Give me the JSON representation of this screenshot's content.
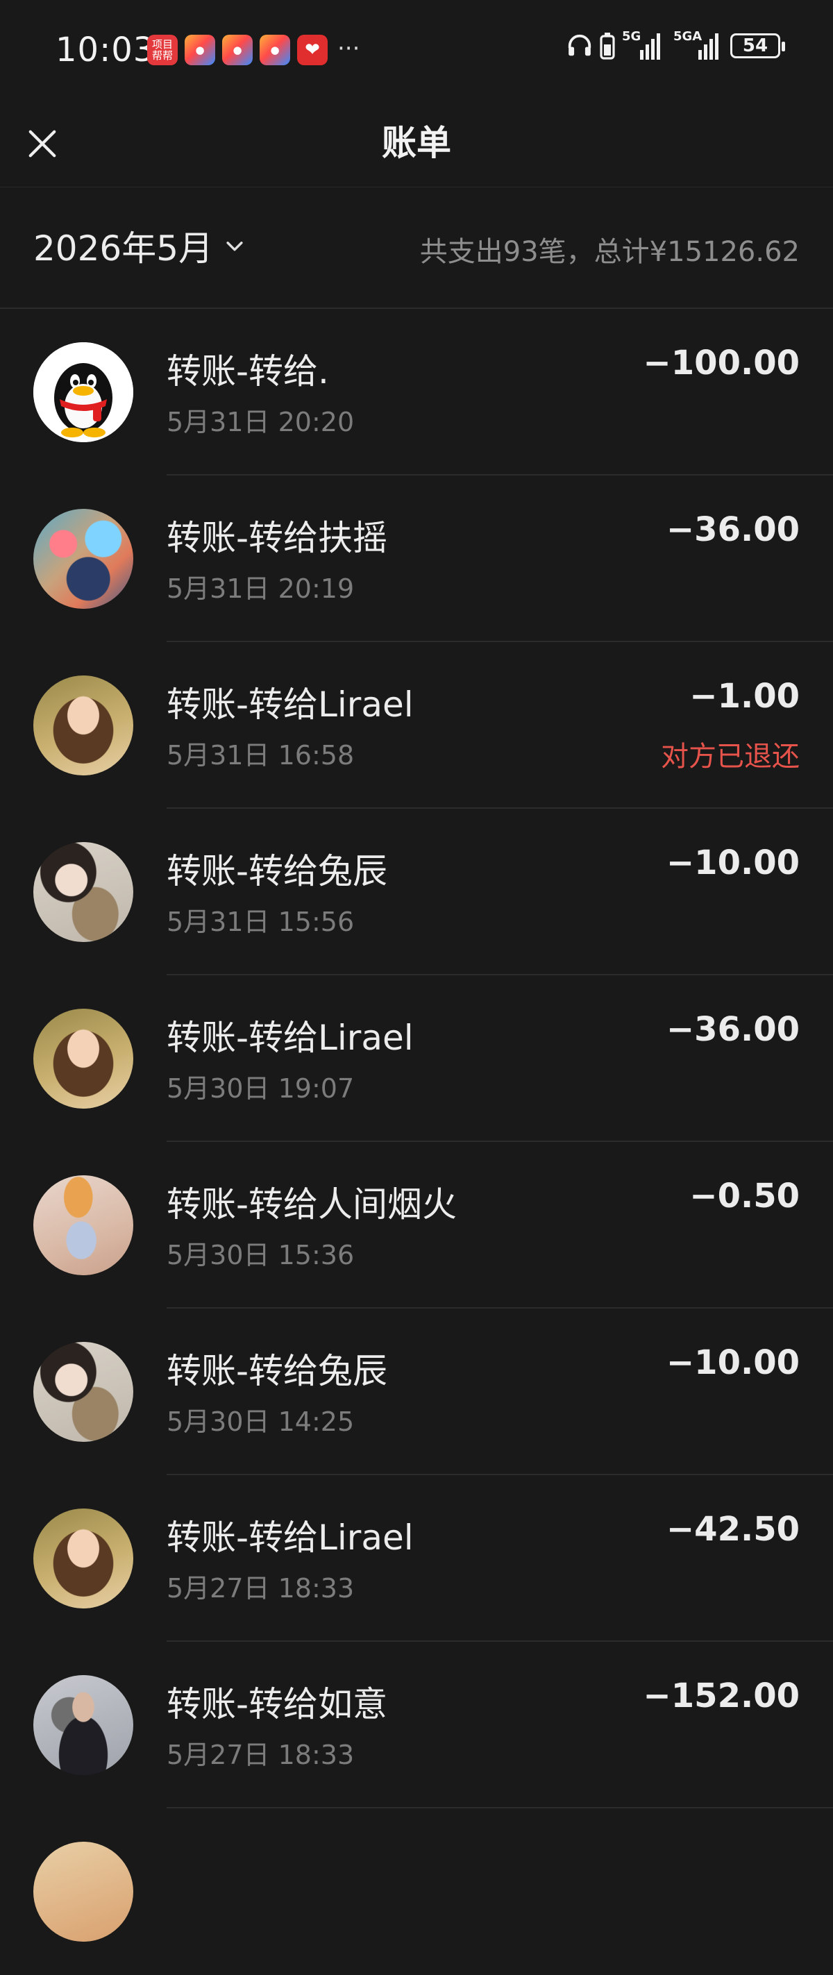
{
  "status_bar": {
    "time": "10:03",
    "app_icon_xmbb": "项目帮帮",
    "more": "···",
    "signal1_label": "5G",
    "signal2_label": "5GA",
    "battery": "54"
  },
  "header": {
    "title": "账单"
  },
  "filter": {
    "month": "2026年5月",
    "summary": "共支出93笔，总计¥15126.62"
  },
  "transactions": [
    {
      "title": "转账-转给.",
      "time": "5月31日 20:20",
      "amount": "−100.00",
      "status": ""
    },
    {
      "title": "转账-转给扶摇",
      "time": "5月31日 20:19",
      "amount": "−36.00",
      "status": ""
    },
    {
      "title": "转账-转给Lirael",
      "time": "5月31日 16:58",
      "amount": "−1.00",
      "status": "对方已退还"
    },
    {
      "title": "转账-转给兔辰",
      "time": "5月31日 15:56",
      "amount": "−10.00",
      "status": ""
    },
    {
      "title": "转账-转给Lirael",
      "time": "5月30日 19:07",
      "amount": "−36.00",
      "status": ""
    },
    {
      "title": "转账-转给人间烟火",
      "time": "5月30日 15:36",
      "amount": "−0.50",
      "status": ""
    },
    {
      "title": "转账-转给兔辰",
      "time": "5月30日 14:25",
      "amount": "−10.00",
      "status": ""
    },
    {
      "title": "转账-转给Lirael",
      "time": "5月27日 18:33",
      "amount": "−42.50",
      "status": ""
    },
    {
      "title": "转账-转给如意",
      "time": "5月27日 18:33",
      "amount": "−152.00",
      "status": ""
    }
  ],
  "colors": {
    "background": "#191919",
    "text_primary": "#ececec",
    "text_secondary": "#7c7c7c",
    "refund_status": "#e5534b"
  }
}
